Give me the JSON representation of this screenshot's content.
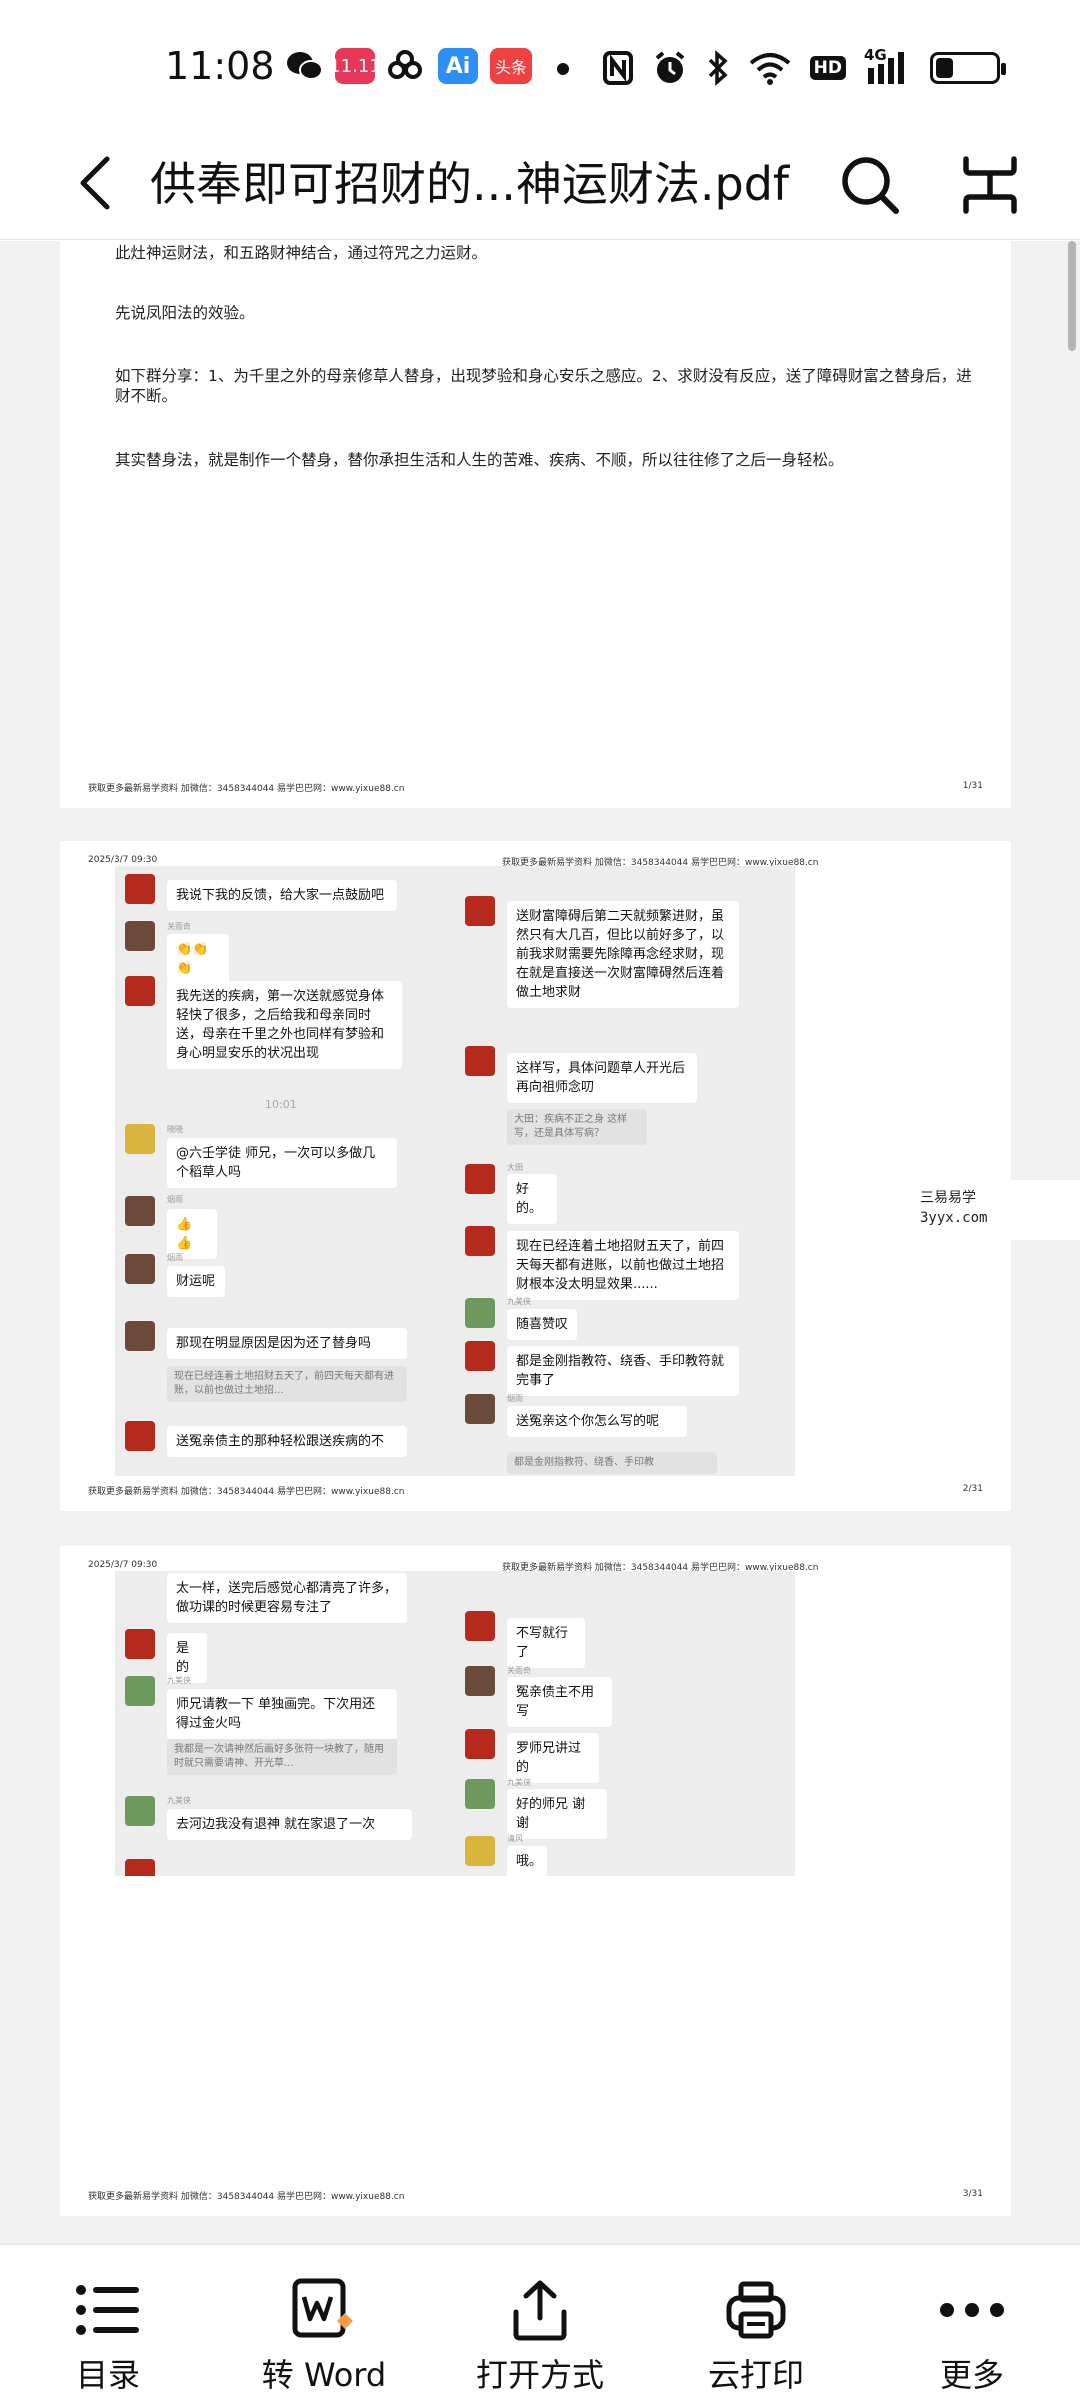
{
  "status_bar": {
    "time": "11:08",
    "apps": [
      "wechat-icon",
      "app-1111-icon",
      "cloud-link-icon",
      "ai-icon",
      "toutiao-icon"
    ],
    "ai_label": "Ai",
    "toutiao_label": "头条",
    "app_badge_label": "11.11",
    "network_label": "4G",
    "hd_label": "HD",
    "battery_percent": 30
  },
  "title_bar": {
    "title": "供奉即可招财的...神运财法.pdf"
  },
  "pages": {
    "p1": {
      "lines": [
        "此灶神运财法，和五路财神结合，通过符咒之力运财。",
        "先说凤阳法的效验。",
        "如下群分享：1、为千里之外的母亲修草人替身，出现梦验和身心安乐之感应。2、求财没有反应，送了障碍财富之替身后，进财不断。",
        "其实替身法，就是制作一个替身，替你承担生活和人生的苦难、疾病、不顺，所以往往修了之后一身轻松。"
      ],
      "footer": "获取更多最新易学资料 加微信：3458344044 易学巴巴网：www.yixue88.cn",
      "page_num": "1/31"
    },
    "p2": {
      "date": "2025/3/7 09:30",
      "header": "获取更多最新易学资料 加微信：3458344044 易学巴巴网：www.yixue88.cn",
      "left_chat": [
        "我说下我的反馈，给大家一点鼓励吧",
        "👏👏👏",
        "我先送的疾病，第一次送就感觉身体轻快了很多，之后给我和母亲同时送，母亲在千里之外也同样有梦验和身心明显安乐的状况出现",
        "10:01",
        "@六壬学徒 师兄，一次可以多做几个稻草人吗",
        "👍👍",
        "财运呢",
        "那现在明显原因是因为还了替身吗",
        "现在已经连着土地招财五天了，前四天每天都有进账，以前也做过土地招...",
        "送冤亲债主的那种轻松跟送疾病的不"
      ],
      "left_names": [
        "关雨奇",
        "晓晓",
        "烟雨",
        "烟雨"
      ],
      "right_chat": [
        "送财富障碍后第二天就频繁进财，虽然只有大几百，但比以前好多了，以前我求财需要先除障再念经求财，现在就是直接送一次财富障碍然后连着做土地求财",
        "这样写，具体问题草人开光后再向祖师念叨",
        "大田：疾病不正之身 这样写，还是具体写病？",
        "好的。",
        "现在已经连着土地招财五天了，前四天每天都有进账，以前也做过土地招财根本没太明显效果......",
        "随喜赞叹",
        "都是金刚指教符、绕香、手印教符就完事了",
        "送冤亲这个你怎么写的呢",
        "都是金刚指教符、绕香、手印教"
      ],
      "right_names": [
        "大田",
        "九美侠",
        "烟雨"
      ],
      "footer": "获取更多最新易学资料 加微信：3458344044 易学巴巴网：www.yixue88.cn",
      "page_num": "2/31"
    },
    "p3": {
      "date": "2025/3/7 09:30",
      "header": "获取更多最新易学资料 加微信：3458344044 易学巴巴网：www.yixue88.cn",
      "left_chat": [
        "太一样，送完后感觉心都清亮了许多，做功课的时候更容易专注了",
        "是的",
        "师兄请教一下 单独画完。下次用还得过金火吗",
        "我都是一次请神然后画好多张符一块教了，随用时就只需要请神、开光草...",
        "去河边我没有退神 就在家退了一次"
      ],
      "left_names": [
        "九美侠",
        "九美侠"
      ],
      "right_chat": [
        "不写就行了",
        "冤亲债主不用写",
        "罗师兄讲过的",
        "好的师兄 谢谢",
        "哦。"
      ],
      "right_names": [
        "关雨奇",
        "九美侠",
        "清风"
      ],
      "footer": "获取更多最新易学资料 加微信：3458344044 易学巴巴网：www.yixue88.cn",
      "page_num": "3/31"
    }
  },
  "watermark": {
    "line1": "三易易学",
    "line2": "3yyx.com"
  },
  "bottom_toolbar": {
    "items": [
      {
        "label": "目录",
        "icon": "list-icon"
      },
      {
        "label": "转 Word",
        "icon": "word-convert-icon"
      },
      {
        "label": "打开方式",
        "icon": "share-icon"
      },
      {
        "label": "云打印",
        "icon": "printer-icon"
      },
      {
        "label": "更多",
        "icon": "more-icon"
      }
    ]
  }
}
